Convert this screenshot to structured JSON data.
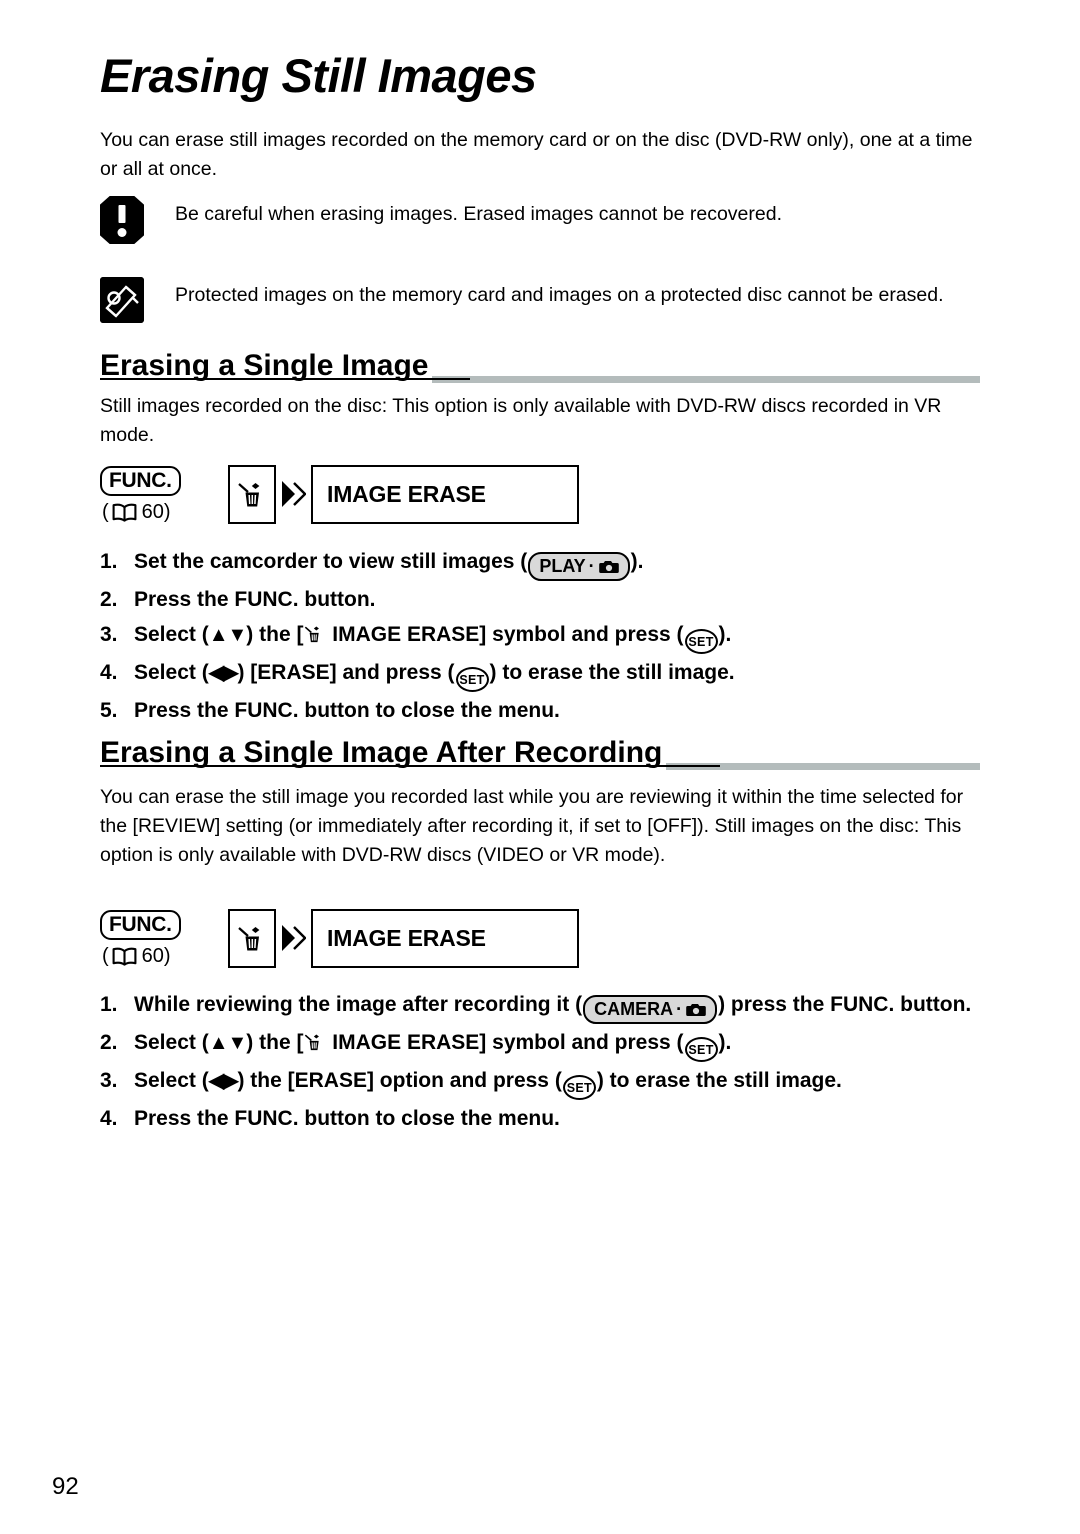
{
  "document": {
    "title": "Erasing Still Images",
    "page_number": "92"
  },
  "intro_paragraph": "You can erase still images recorded on the memory card or on the disc (DVD-RW only), one at a time or all at once.",
  "notes": [
    {
      "icon": "caution-icon",
      "text": "Be careful when erasing images. Erased images cannot be recovered."
    },
    {
      "icon": "note-pencil-icon",
      "text": "Protected images on the memory card and images on a protected disc cannot be erased."
    }
  ],
  "sections": [
    {
      "heading": "Erasing a Single Image",
      "paragraph": "Still images recorded on the disc: This option is only available with DVD-RW discs recorded in VR mode.",
      "menu_diagram": {
        "func_label": "FUNC.",
        "page_ref_open": "(",
        "page_ref_number": "60",
        "page_ref_close": ")",
        "icon": "trash-image-erase-icon",
        "arrow": "double-chevron-right",
        "menu_item": "IMAGE ERASE"
      },
      "steps": [
        {
          "number": "1.",
          "pre": "Set the camcorder to view still images (",
          "badge": "PLAY",
          "post": ")."
        },
        {
          "number": "2.",
          "pre": "Press the FUNC. button.",
          "post": ""
        },
        {
          "number": "3.",
          "pre": "Select (",
          "arrows": "updown",
          "mid": ") the [",
          "trash": true,
          "mid2": " IMAGE ERASE] symbol and press (",
          "set": "SET",
          "post": ")."
        },
        {
          "number": "4.",
          "pre": "Select (",
          "arrows": "leftright",
          "mid": ") [ERASE] and press (",
          "set": "SET",
          "post": ") to erase the still image."
        },
        {
          "number": "5.",
          "pre": "Press the FUNC. button to close the menu.",
          "post": ""
        }
      ]
    },
    {
      "heading": "Erasing a Single Image After Recording",
      "paragraph": "You can erase the still image you recorded last while you are reviewing it within the time selected for the [REVIEW] setting (or immediately after recording it, if set to [OFF]). Still images on the disc: This option is only available with DVD-RW discs (VIDEO or VR mode).",
      "menu_diagram": {
        "func_label": "FUNC.",
        "page_ref_open": "(",
        "page_ref_number": "60",
        "page_ref_close": ")",
        "icon": "trash-image-erase-icon",
        "arrow": "double-chevron-right",
        "menu_item": "IMAGE ERASE"
      },
      "steps": [
        {
          "number": "1.",
          "pre": "While reviewing the image after recording it (",
          "badge": "CAMERA",
          "post": ") press the FUNC. button."
        },
        {
          "number": "2.",
          "pre": "Select (",
          "arrows": "updown",
          "mid": ") the [",
          "trash": true,
          "mid2": " IMAGE ERASE] symbol and press (",
          "set": "SET",
          "post": ")."
        },
        {
          "number": "3.",
          "pre": "Select (",
          "arrows": "leftright",
          "mid": ") the [ERASE] option and press (",
          "set": "SET",
          "post": ") to erase the still image."
        },
        {
          "number": "4.",
          "pre": "Press the FUNC. button to close the menu.",
          "post": ""
        }
      ]
    }
  ],
  "glyphs": {
    "set_label": "SET",
    "play_label": "PLAY",
    "camera_label": "CAMERA",
    "separator_dot": "·",
    "up_down_arrows": "▲▼",
    "left_right_arrows": "◀▶"
  },
  "colors": {
    "rule_gray": "#b4bcbc",
    "badge_fill": "#d9d9d9",
    "ink": "#000000",
    "paper": "#ffffff"
  }
}
